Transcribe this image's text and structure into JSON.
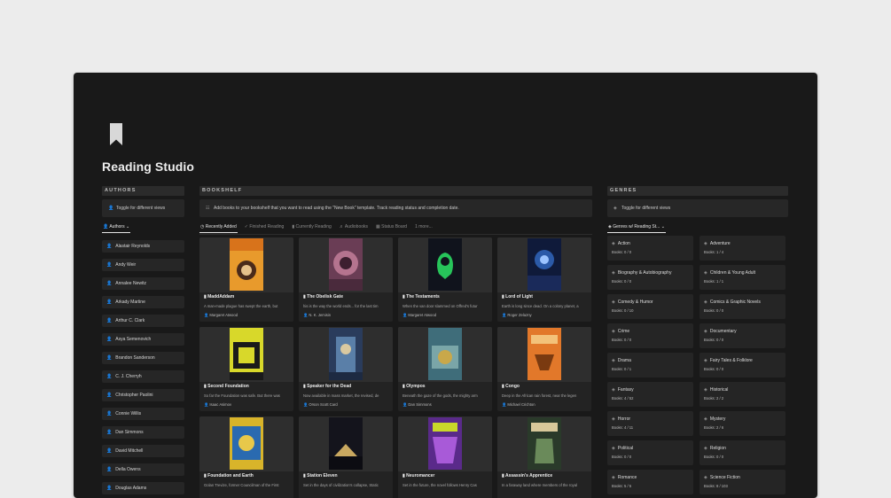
{
  "page": {
    "title": "Reading Studio",
    "icon": "bookmark-icon"
  },
  "authors": {
    "header": "AUTHORS",
    "toggle": "Toggle for different views",
    "view": "Authors",
    "items": [
      "Alastair Reynolds",
      "Andy Weir",
      "Annalee Newitz",
      "Arkady Martine",
      "Arthur C. Clark",
      "Asya Semenovich",
      "Brandon Sanderson",
      "C. J. Cherryh",
      "Christopher Paolini",
      "Connie Willis",
      "Dan Simmons",
      "David Mitchell",
      "Della Owens",
      "Douglas Adams"
    ]
  },
  "bookshelf": {
    "header": "BOOKSHELF",
    "note": "Add books to your bookshelf that you want to read using the \"New Book\" template. Track reading status and completion date.",
    "tabs": [
      "Recently Added",
      "Finished Reading",
      "Currently Reading",
      "Audiobooks",
      "Status Board",
      "1 more..."
    ],
    "books": [
      {
        "title": "MaddAddam",
        "desc": "A man-made plague has swept the earth, but",
        "author": "Margaret Atwood",
        "cover_text": "MARGARET ATWOOD"
      },
      {
        "title": "The Obelisk Gate",
        "desc": "his is the way the world ends... for the last tim",
        "author": "N. K. Jemisin",
        "cover_text": "OBELISK GATE"
      },
      {
        "title": "The Testaments",
        "desc": "When the van door slammed on Offred's futur",
        "author": "Margaret Atwood",
        "cover_text": "ATWOOD"
      },
      {
        "title": "Lord of Light",
        "desc": "Earth is long since dead. On a colony planet, a",
        "author": "Roger Zelazny",
        "cover_text": "ROGER ZELAZNY"
      },
      {
        "title": "Second Foundation",
        "desc": "So far the Foundation was safe. But there was",
        "author": "Isaac Asimov",
        "cover_text": "ASIMOV"
      },
      {
        "title": "Speaker for the Dead",
        "desc": "Now available in mass market, the revised, de",
        "author": "Orson Scott Card",
        "cover_text": "SPEAKER"
      },
      {
        "title": "Olympos",
        "desc": "Beneath the gaze of the gods, the mighty arm",
        "author": "Dan Simmons",
        "cover_text": "OLYMPOS"
      },
      {
        "title": "Congo",
        "desc": "Deep in the African rain forest, near the legen",
        "author": "Michael Crichton",
        "cover_text": "CONGO"
      },
      {
        "title": "Foundation and Earth",
        "desc": "Golan Trevize, former Councilman of the First",
        "author": "",
        "cover_text": "ASIMOV"
      },
      {
        "title": "Station Eleven",
        "desc": "Set in the days of civilization's collapse, Static",
        "author": "",
        "cover_text": "STATION ELEVEN"
      },
      {
        "title": "Neuromancer",
        "desc": "Set in the future, the novel follows Henry Cas",
        "author": "",
        "cover_text": "NEUROMANCER"
      },
      {
        "title": "Assassin's Apprentice",
        "desc": "In a faraway land where members of the royal",
        "author": "",
        "cover_text": "HOBB"
      }
    ]
  },
  "genres": {
    "header": "GENRES",
    "toggle": "Toggle for different views",
    "view": "Genres w/ Reading St...",
    "items": [
      {
        "name": "Action",
        "count": "Books: 0 / 0"
      },
      {
        "name": "Adventure",
        "count": "Books: 1 / 4"
      },
      {
        "name": "Biography & Autobiography",
        "count": "Books: 0 / 0"
      },
      {
        "name": "Children & Young Adult",
        "count": "Books: 1 / 1"
      },
      {
        "name": "Comedy & Humor",
        "count": "Books: 0 / 10"
      },
      {
        "name": "Comics & Graphic Novels",
        "count": "Books: 0 / 0"
      },
      {
        "name": "Crime",
        "count": "Books: 0 / 0"
      },
      {
        "name": "Documentary",
        "count": "Books: 0 / 0"
      },
      {
        "name": "Drama",
        "count": "Books: 0 / 1"
      },
      {
        "name": "Fairy Tales & Folklore",
        "count": "Books: 0 / 0"
      },
      {
        "name": "Fantasy",
        "count": "Books: 4 / 52"
      },
      {
        "name": "Historical",
        "count": "Books: 2 / 2"
      },
      {
        "name": "Horror",
        "count": "Books: 4 / 11"
      },
      {
        "name": "Mystery",
        "count": "Books: 2 / 6"
      },
      {
        "name": "Political",
        "count": "Books: 0 / 0"
      },
      {
        "name": "Religion",
        "count": "Books: 0 / 0"
      },
      {
        "name": "Romance",
        "count": "Books: 5 / 5"
      },
      {
        "name": "Science Fiction",
        "count": "Books: 8 / 103"
      }
    ]
  }
}
